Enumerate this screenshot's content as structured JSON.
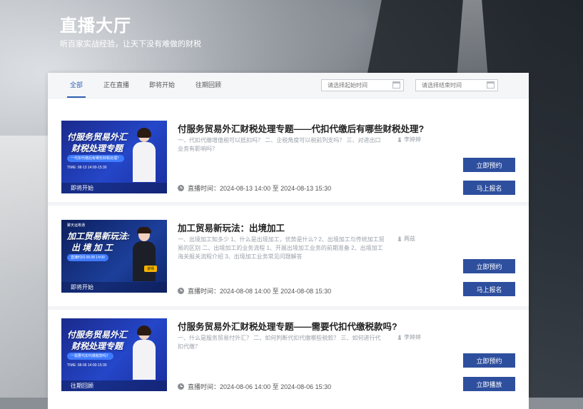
{
  "hero": {
    "title": "直播大厅",
    "subtitle": "听百家实战经验，让天下没有难做的财税"
  },
  "tabs": [
    {
      "label": "全部",
      "active": true
    },
    {
      "label": "正在直播",
      "active": false
    },
    {
      "label": "即将开始",
      "active": false
    },
    {
      "label": "往期回顾",
      "active": false
    }
  ],
  "filters": {
    "start_placeholder": "请选择起始时间",
    "end_placeholder": "请选择结束时间"
  },
  "time_prefix": "直播时间：",
  "time_separator": "至",
  "colors": {
    "accent": "#2f5fb3",
    "button": "#2e4f9e"
  },
  "courses": [
    {
      "title": "付服务贸易外汇财税处理专题——代扣代缴后有哪些财税处理?",
      "desc": "一、代扣代缴增值税可以抵扣吗？ 二、企税角度可以税前列支吗？ 三、对进出口业务有影响吗？",
      "author": "李婷婷",
      "start": "2024-08-13 14:00",
      "end": "2024-08-13 15:30",
      "status": "即将开始",
      "btn1": "立即预约",
      "btn2": "马上报名",
      "thumb": {
        "line1": "付服务贸易外汇",
        "line2": "财税处理专题",
        "pill": "一代扣代缴后有哪些财税处理？",
        "time": "TIME: 08-13 14:00-15:30"
      }
    },
    {
      "title": "加工贸易新玩法：出境加工",
      "desc": "一、出境加工知多少 1、什么是出境加工，优势是什么? 2、出境加工与传统加工贸易的区别 二、出境加工的业务流程 1、开展出境加工业务的前期准备 2、出境加工海关报关流程介绍 3、出境加工业务常见问题解答",
      "author": "两兹",
      "start": "2024-08-08 14:00",
      "end": "2024-08-08 15:30",
      "status": "即将开始",
      "btn1": "立即预约",
      "btn2": "马上报名",
      "thumb": {
        "logo": "聚天运筹通",
        "line1": "加工贸易新玩法:",
        "line2": "出 境 加 工",
        "pill": "直播时间 08.08 14:00",
        "badge": "讲师"
      }
    },
    {
      "title": "付服务贸易外汇财税处理专题——需要代扣代缴税款吗?",
      "desc": "一、什么是服务贸易付外汇？ 二、如何判断代扣代缴哪些税款？ 三、如何进行代扣代缴？",
      "author": "李婷婷",
      "start": "2024-08-06 14:00",
      "end": "2024-08-06 15:30",
      "status": "往期回顾",
      "btn1": "立即预约",
      "btn2": "立即播放",
      "thumb": {
        "line1": "付服务贸易外汇",
        "line2": "财税处理专题",
        "pill": "一需要代扣代缴税款吗？",
        "time": "TIME: 08-06 14:00-15:30"
      }
    }
  ]
}
